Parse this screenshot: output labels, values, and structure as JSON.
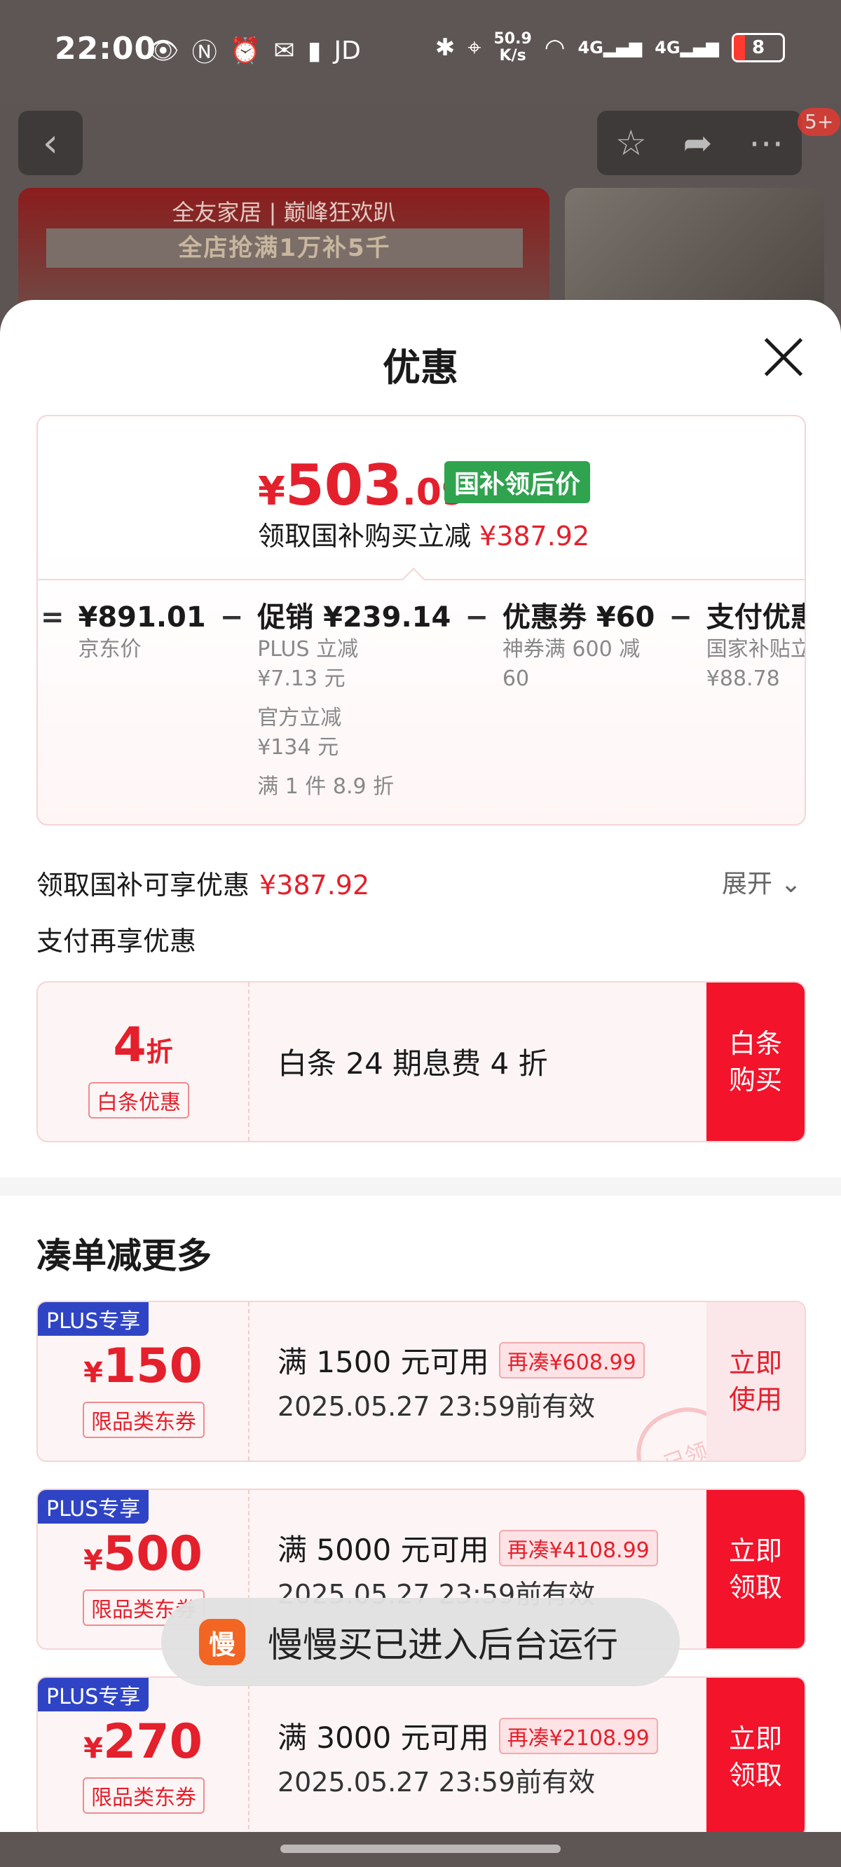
{
  "status_bar": {
    "time": "22:00",
    "network_speed_value": "50.9",
    "network_speed_unit": "K/s",
    "carrier_label": "JD",
    "signal1": "4G",
    "signal2": "4G",
    "battery": "8"
  },
  "header": {
    "cart_badge": "5+",
    "banner_line1": "全友家居 | 巅峰狂欢趴",
    "banner_line2": "全店抢满1万补5千"
  },
  "sheet": {
    "title": "优惠",
    "final_price": {
      "yen": "¥",
      "int": "503",
      "dec": ".09"
    },
    "gov_tag": "国补领后价",
    "save_text": "领取国补购买立减",
    "save_amount": "¥387.92",
    "breakdown": [
      {
        "op": "=",
        "title": "¥891.01",
        "sub1": "京东价"
      },
      {
        "op": "−",
        "title": "促销 ¥239.14",
        "sub1": "PLUS 立减\n¥7.13 元",
        "sub2": "官方立减\n¥134 元",
        "sub3": "满 1 件 8.9 折"
      },
      {
        "op": "−",
        "title": "优惠券 ¥60",
        "sub1": "神券满 600 减\n60"
      },
      {
        "op": "−",
        "title": "支付优惠",
        "sub1": "国家补贴立\n¥88.78"
      }
    ],
    "gov_row_label": "领取国补可享优惠",
    "gov_row_amount": "¥387.92",
    "expand_label": "展开",
    "pay_title": "支付再享优惠",
    "baitiao": {
      "discount_num": "4",
      "discount_unit": "折",
      "tag": "白条优惠",
      "desc": "白条 24 期息费 4 折",
      "button": "白条\n购买"
    },
    "more_title": "凑单减更多",
    "coupons": [
      {
        "plus": "PLUS专享",
        "yen": "¥",
        "value": "150",
        "kind": "限品类东券",
        "cond": "满 1500 元可用",
        "add": "再凑¥608.99",
        "date": "2025.05.27 23:59前有效",
        "button": "立即\n使用",
        "stamp": "已领"
      },
      {
        "plus": "PLUS专享",
        "yen": "¥",
        "value": "500",
        "kind": "限品类东券",
        "cond": "满 5000 元可用",
        "add": "再凑¥4108.99",
        "date": "2025.05.27 23:59前有效",
        "button": "立即\n领取"
      },
      {
        "plus": "PLUS专享",
        "yen": "¥",
        "value": "270",
        "kind": "限品类东券",
        "cond": "满 3000 元可用",
        "add": "再凑¥2108.99",
        "date": "2025.05.27 23:59前有效",
        "button": "立即\n领取"
      }
    ]
  },
  "toast": {
    "app_icon_text": "慢",
    "message": "慢慢买已进入后台运行"
  }
}
